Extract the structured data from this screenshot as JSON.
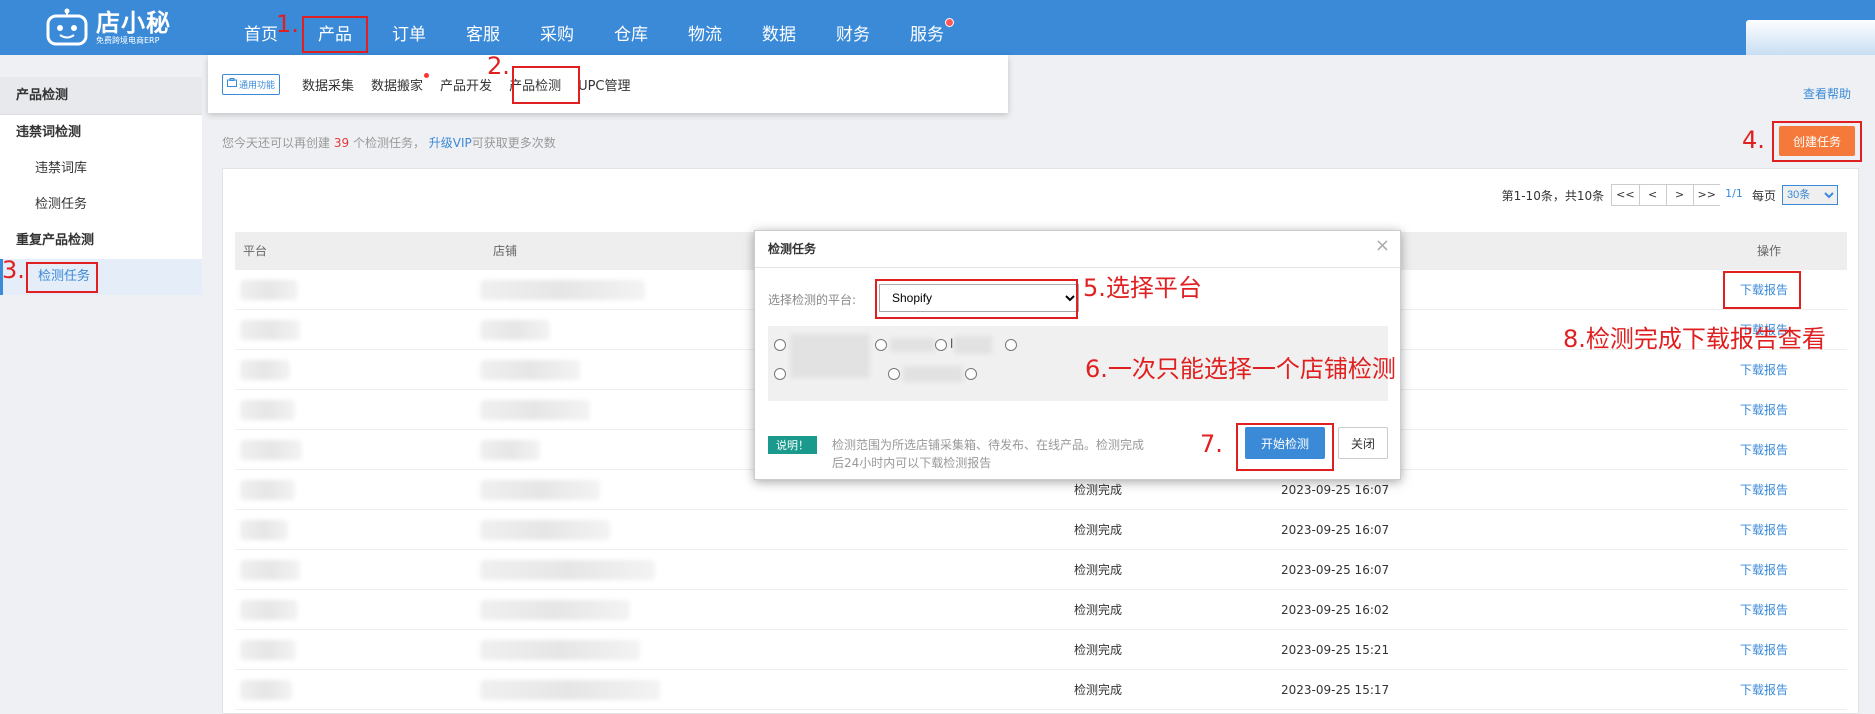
{
  "header": {
    "logo_title": "店小秘",
    "logo_sub": "免费跨境电商ERP",
    "nav": [
      "首页",
      "产品",
      "订单",
      "客服",
      "采购",
      "仓库",
      "物流",
      "数据",
      "财务",
      "服务"
    ]
  },
  "submenu": {
    "common_tag": "通用功能",
    "items": [
      "数据采集",
      "数据搬家",
      "产品开发",
      "产品检测",
      "UPC管理"
    ]
  },
  "sidebar": {
    "section": "产品检测",
    "group1": "违禁词检测",
    "group1_items": [
      "违禁词库",
      "检测任务"
    ],
    "group2": "重复产品检测",
    "group2_items": [
      "检测任务"
    ]
  },
  "help_link": "查看帮助",
  "notice": {
    "prefix": "您今天还可以再创建",
    "count": "39",
    "suffix": "个检测任务，",
    "vip": "升级VIP",
    "tail": "可获取更多次数"
  },
  "create_button": "创建任务",
  "pager": {
    "summary": "第1-10条，共10条",
    "buttons": [
      "<<",
      "<",
      ">",
      ">>"
    ],
    "current": "1/1",
    "per_page_label": "每页",
    "per_page": "30条"
  },
  "table": {
    "headers": [
      "平台",
      "店铺",
      "操作"
    ],
    "rows": [
      {
        "status": "",
        "time": "",
        "action": "下载报告"
      },
      {
        "status": "",
        "time": "",
        "action": "下载报告"
      },
      {
        "status": "",
        "time": "",
        "action": "下载报告"
      },
      {
        "status": "",
        "time": "",
        "action": "下载报告"
      },
      {
        "status": "",
        "time": "",
        "action": "下载报告"
      },
      {
        "status": "检测完成",
        "time": "2023-09-25 16:07",
        "action": "下载报告"
      },
      {
        "status": "检测完成",
        "time": "2023-09-25 16:07",
        "action": "下载报告"
      },
      {
        "status": "检测完成",
        "time": "2023-09-25 16:07",
        "action": "下载报告"
      },
      {
        "status": "检测完成",
        "time": "2023-09-25 16:02",
        "action": "下载报告"
      },
      {
        "status": "检测完成",
        "time": "2023-09-25 15:21",
        "action": "下载报告"
      },
      {
        "status": "检测完成",
        "time": "2023-09-25 15:17",
        "action": "下载报告"
      }
    ]
  },
  "modal": {
    "title": "检测任务",
    "close": "×",
    "platform_label": "选择检测的平台:",
    "platform_value": "Shopify",
    "shop_fragment": "l",
    "note_badge": "说明！",
    "note_text": "检测范围为所选店铺采集箱、待发布、在线产品。检测完成后24小时内可以下载检测报告",
    "start_button": "开始检测",
    "close_button": "关闭"
  },
  "annotations": {
    "a1": "1.",
    "a2": "2.",
    "a3": "3.",
    "a4": "4.",
    "a5": "5.选择平台",
    "a6": "6.一次只能选择一个店铺检测",
    "a7": "7.",
    "a8": "8.检测完成下载报告查看"
  },
  "colors": {
    "brand": "#3a8ad8",
    "create": "#f5793b",
    "annotation": "#e02020",
    "note_badge": "#1a9a8d"
  }
}
